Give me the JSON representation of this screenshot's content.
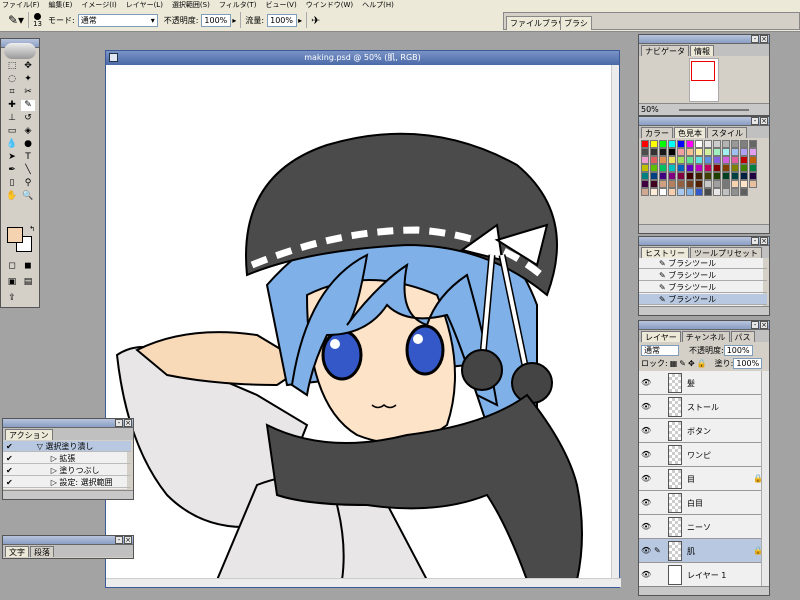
{
  "menu": [
    "ファイル(F)",
    "編集(E)",
    "イメージ(I)",
    "レイヤー(L)",
    "選択範囲(S)",
    "フィルタ(T)",
    "ビュー(V)",
    "ウインドウ(W)",
    "ヘルプ(H)"
  ],
  "options": {
    "brush_size": "13",
    "mode_label": "モード:",
    "mode_value": "通常",
    "opacity_label": "不透明度:",
    "opacity_value": "100%",
    "flow_label": "流量:",
    "flow_value": "100%"
  },
  "palette_well": {
    "tabs": [
      "ファイルブラウザ",
      "ブラシ"
    ]
  },
  "document": {
    "title": "making.psd @ 50% (肌, RGB)"
  },
  "colors": {
    "foreground": "#f5d3b0",
    "background": "#ffffff"
  },
  "navigator": {
    "tabs": [
      "ナビゲータ",
      "情報"
    ],
    "zoom": "50%"
  },
  "swatches_panel": {
    "tabs": [
      "カラー",
      "色見本",
      "スタイル"
    ]
  },
  "history": {
    "tabs": [
      "ヒストリー",
      "ツールプリセット"
    ],
    "items": [
      "ブラシツール",
      "ブラシツール",
      "ブラシツール",
      "ブラシツール"
    ]
  },
  "layers": {
    "tabs": [
      "レイヤー",
      "チャンネル",
      "パス"
    ],
    "mode": "通常",
    "opacity_label": "不透明度:",
    "opacity": "100%",
    "lock_label": "ロック:",
    "fill_label": "塗り:",
    "fill": "100%",
    "items": [
      {
        "name": "髪"
      },
      {
        "name": "ストール"
      },
      {
        "name": "ボタン"
      },
      {
        "name": "ワンピ"
      },
      {
        "name": "目"
      },
      {
        "name": "白目"
      },
      {
        "name": "ニーソ"
      },
      {
        "name": "肌"
      },
      {
        "name": "レイヤー 1"
      }
    ]
  },
  "actions": {
    "tab": "アクション",
    "items": [
      "選択塗り潰し",
      "拡張",
      "塗りつぶし",
      "設定: 選択範囲"
    ]
  },
  "character": {
    "tabs": [
      "文字",
      "段落"
    ]
  }
}
